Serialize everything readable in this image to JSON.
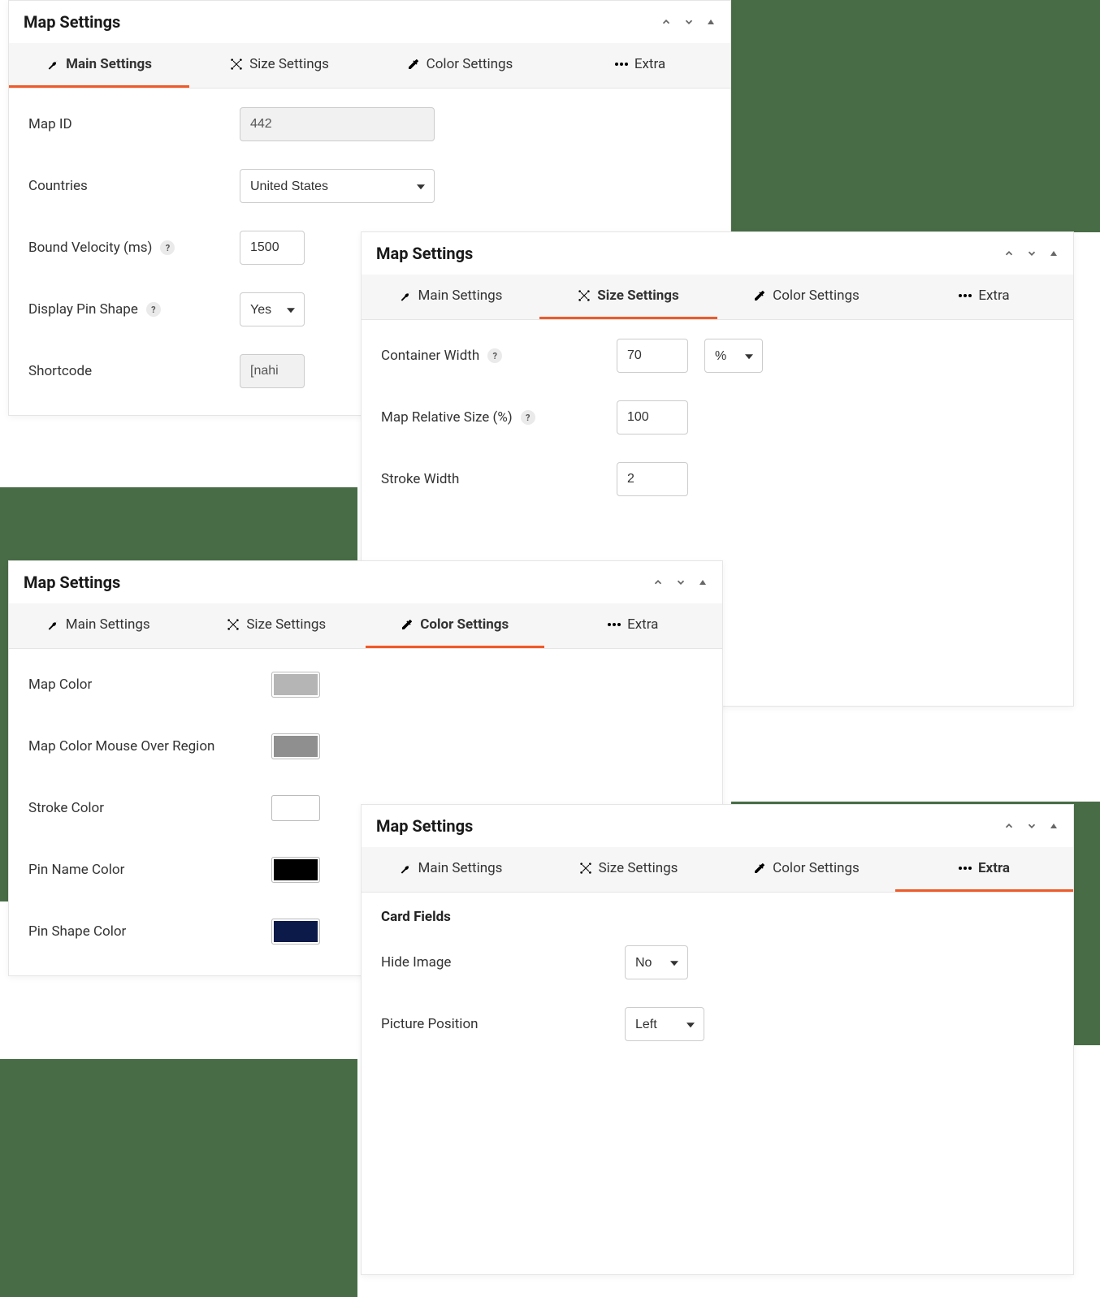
{
  "panel_title": "Map Settings",
  "tabs": {
    "main": "Main Settings",
    "size": "Size Settings",
    "color": "Color Settings",
    "extra": "Extra"
  },
  "main": {
    "map_id_label": "Map ID",
    "map_id_value": "442",
    "countries_label": "Countries",
    "countries_value": "United States",
    "bound_label": "Bound Velocity (ms)",
    "bound_value": "1500",
    "pin_label": "Display Pin Shape",
    "pin_value": "Yes",
    "shortcode_label": "Shortcode",
    "shortcode_value": "[nahi"
  },
  "size": {
    "container_label": "Container Width",
    "container_value": "70",
    "container_unit": "%",
    "rel_label": "Map Relative Size (%)",
    "rel_value": "100",
    "stroke_label": "Stroke Width",
    "stroke_value": "2"
  },
  "color": {
    "map_label": "Map Color",
    "map_value": "#b5b5b5",
    "hover_label": "Map Color Mouse Over Region",
    "hover_value": "#8f8f8f",
    "stroke_label": "Stroke Color",
    "stroke_value": "#ffffff",
    "pin_name_label": "Pin Name Color",
    "pin_name_value": "#000000",
    "pin_shape_label": "Pin Shape Color",
    "pin_shape_value": "#0c1a4a"
  },
  "extra": {
    "section": "Card Fields",
    "hide_label": "Hide Image",
    "hide_value": "No",
    "pos_label": "Picture Position",
    "pos_value": "Left"
  }
}
